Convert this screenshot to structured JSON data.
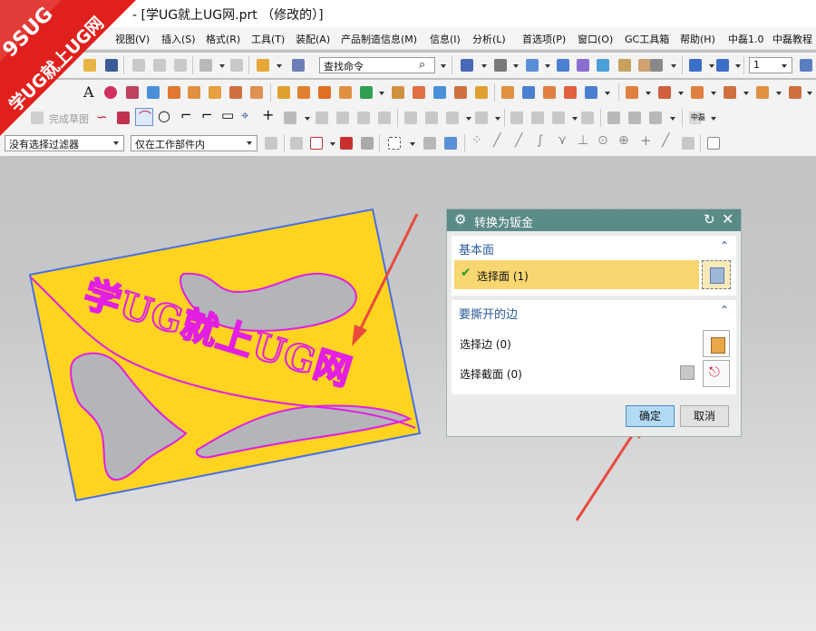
{
  "window": {
    "title": "- [学UG就上UG网.prt （修改的）]"
  },
  "logo": {
    "line1": "9SUG",
    "line2": "学UG就上UG网"
  },
  "menu": [
    "视图(V)",
    "插入(S)",
    "格式(R)",
    "工具(T)",
    "装配(A)",
    "产品制造信息(M)",
    "信息(I)",
    "分析(L)",
    "首选项(P)",
    "窗口(O)",
    "GC工具箱",
    "帮助(H)",
    "中磊1.0",
    "中磊教程"
  ],
  "toolbar": {
    "command_finder_placeholder": "查找命令",
    "quantity_value": "1",
    "finish_sketch_label": "完成草图",
    "zhonglei_label": "中磊",
    "selection_filter_value": "没有选择过滤器",
    "scope_value": "仅在工作部件内"
  },
  "dialog": {
    "title": "转换为钣金",
    "base_face": {
      "header": "基本面",
      "select_face_label": "选择面 (1)"
    },
    "edges_to_rip": {
      "header": "要撕开的边",
      "select_edge_label": "选择边 (0)",
      "select_section_label": "选择截面 (0)"
    },
    "ok_label": "确定",
    "cancel_label": "取消"
  },
  "part_text": "学UG就上UG网",
  "colors": {
    "dialog_header": "#5b8b87",
    "selected_row": "#f8d670",
    "part_face": "#fed420",
    "part_edge": "#e21fe2",
    "panel_header_text": "#2a5a9a",
    "arrow": "#e84a3c",
    "logo_red": "#e0201c"
  },
  "icons": [
    "logo-badge",
    "dialog-settings-icon",
    "reset-icon",
    "close-icon",
    "checkmark-icon",
    "face-select-icon",
    "edge-select-icon",
    "section-select-icon",
    "binoculars-icon"
  ]
}
